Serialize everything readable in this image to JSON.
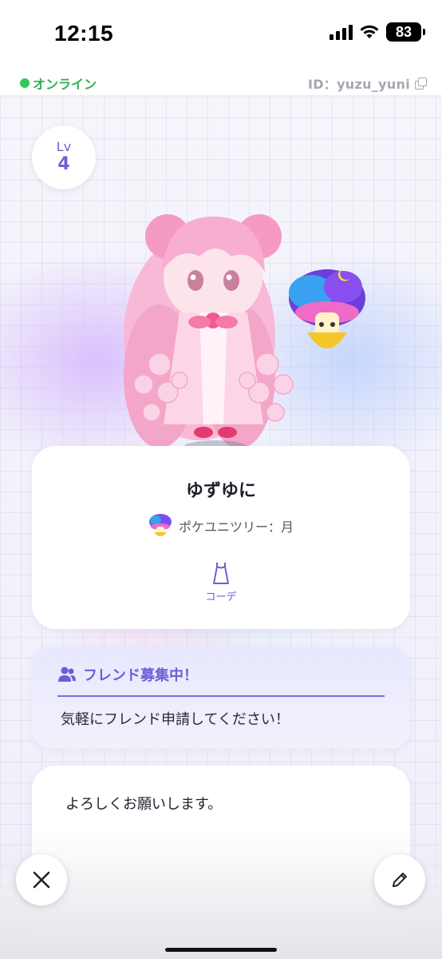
{
  "status_bar": {
    "time": "12:15",
    "battery": "83",
    "icons": [
      "cellular-signal-icon",
      "wifi-icon",
      "battery-icon"
    ]
  },
  "online_bar": {
    "status": "オンライン",
    "status_color": "#35c759",
    "user_id": "ID：yuzu_yuni",
    "icons": [
      "copy-icon"
    ]
  },
  "level": {
    "label": "Lv",
    "value": "4"
  },
  "profile": {
    "name": "ゆずゆに",
    "tree": "ポケユニツリー：月",
    "coord_label": "コーデ",
    "icons": [
      "mushroom-tree-icon",
      "dress-icon"
    ]
  },
  "friend_recruit": {
    "title": "フレンド募集中！",
    "message": "気軽にフレンド申請してください！",
    "icon": "people-icon"
  },
  "message": {
    "text": "よろしくお願いします。"
  },
  "bottom_buttons": {
    "close_icon": "close-icon",
    "edit_icon": "pencil-icon"
  },
  "colors": {
    "accent": "#6b5fd6",
    "online": "#35c759"
  }
}
